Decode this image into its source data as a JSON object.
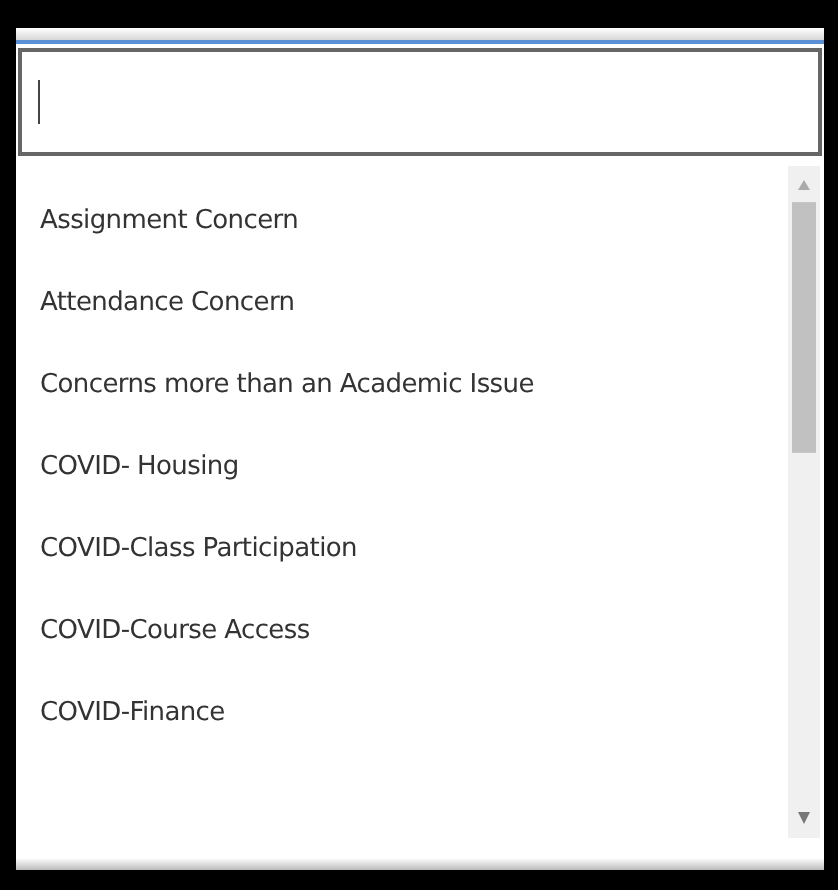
{
  "search": {
    "focused": true
  },
  "options": [
    {
      "label": "Assignment Concern"
    },
    {
      "label": "Attendance Concern"
    },
    {
      "label": "Concerns more than an Academic Issue"
    },
    {
      "label": "COVID- Housing"
    },
    {
      "label": "COVID-Class Participation"
    },
    {
      "label": "COVID-Course Access"
    },
    {
      "label": "COVID-Finance"
    }
  ]
}
